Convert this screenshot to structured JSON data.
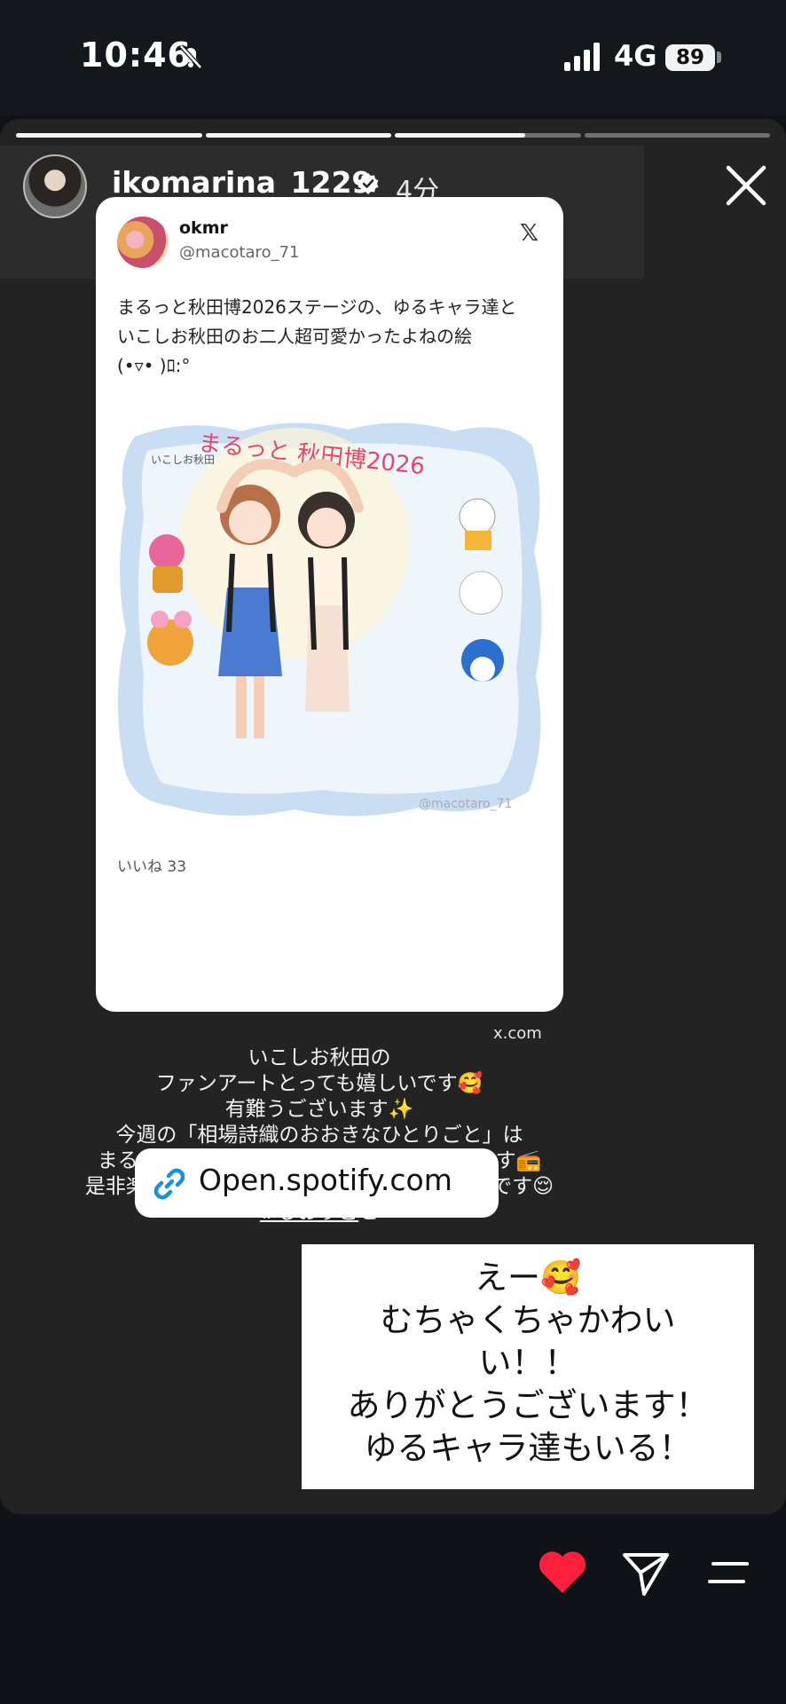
{
  "status_bar": {
    "time": "10:46",
    "network": "4G",
    "battery": "89"
  },
  "story": {
    "username": "ikomarina_1229",
    "time_ago": "4分",
    "progress_segments": 4,
    "active_segment": 3,
    "active_segment_progress": 0.7
  },
  "tweet": {
    "name": "okmr",
    "handle": "@macotaro_71",
    "text": "まるっと秋田博2026ステージの、ゆるキャラ達と\nいこしお秋田のお二人超可愛かったよねの絵\n(•▿• )ﾛ:°",
    "art_title": "まるっと 秋田博2026",
    "art_badge": "いこしお秋田",
    "art_watermark": "@macotaro_71",
    "likes": "いいね 33",
    "domain": "x.com"
  },
  "caption": {
    "lines": [
      "いこしお秋田の",
      "ファンアートとっても嬉しいです🥰",
      "有難うございます✨",
      "今週の「相場詩織のおおきなひとりごと」は",
      "まるっと秋田博2026の振り返りもしています📻",
      "是非楽しさの余韻に浸っていただければ幸いです😌"
    ],
    "hashtag": "#しおりご",
    "hashtag_tail": "と"
  },
  "link_sticker": {
    "label": "Open.spotify.com"
  },
  "reply": {
    "lines": [
      "えー🥰",
      "むちゃくちゃかわい",
      "い！！",
      "ありがとうございます！",
      "ゆるキャラ達もいる！"
    ]
  },
  "icons": {
    "mute": "bell-slash-icon",
    "signal": "signal-bars-icon",
    "verified": "verified-badge-icon",
    "close": "close-icon",
    "link": "link-icon",
    "heart": "heart-icon",
    "send": "send-icon",
    "menu": "menu-icon"
  },
  "colors": {
    "heart": "#ff1f3d",
    "link_icon": "#1d8fe1",
    "story_bg": "#232323"
  }
}
